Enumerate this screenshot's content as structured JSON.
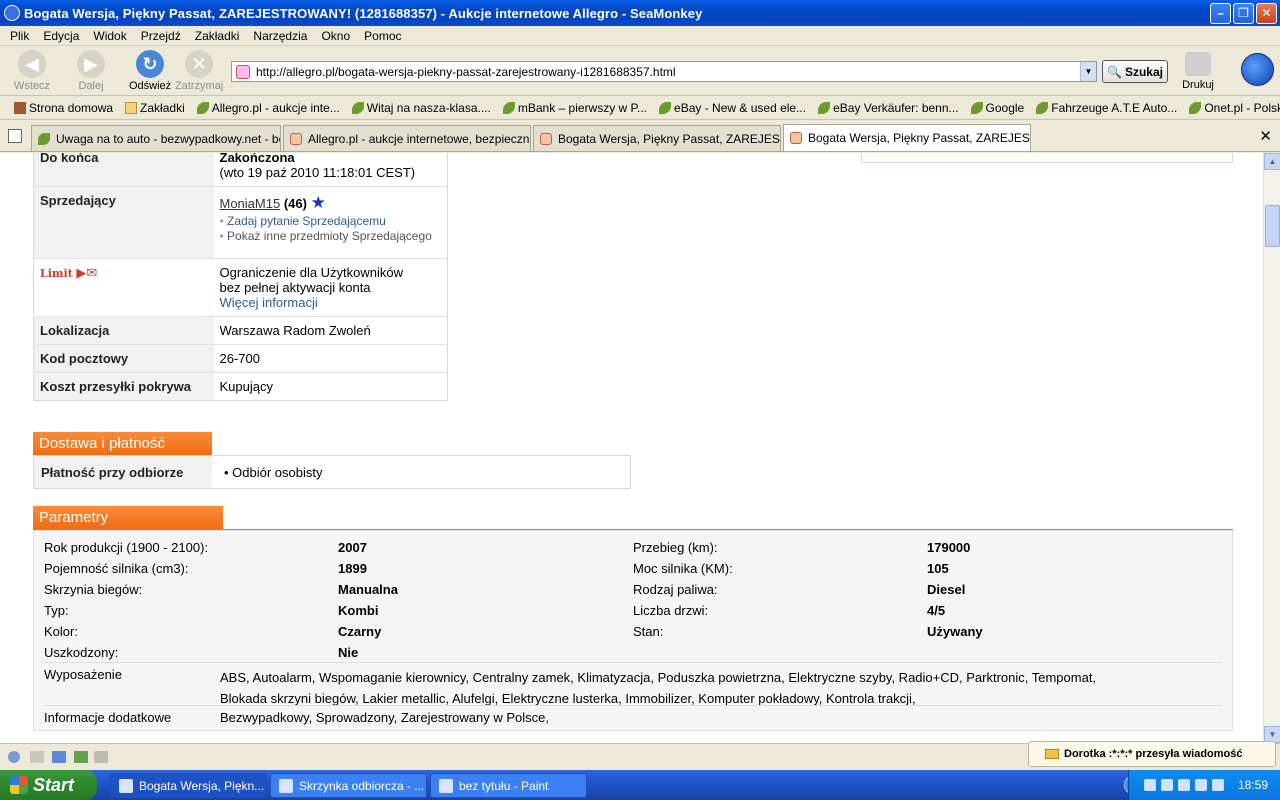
{
  "window": {
    "title": "Bogata Wersja, Piękny Passat, ZAREJESTROWANY! (1281688357) - Aukcje internetowe Allegro - SeaMonkey"
  },
  "menu": [
    "Plik",
    "Edycja",
    "Widok",
    "Przejdź",
    "Zakładki",
    "Narzędzia",
    "Okno",
    "Pomoc"
  ],
  "nav": {
    "back": "Wstecz",
    "forward": "Dalej",
    "reload": "Odśwież",
    "stop": "Zatrzymaj",
    "url": "http://allegro.pl/bogata-wersja-piekny-passat-zarejestrowany-i1281688357.html",
    "search": "Szukaj",
    "print": "Drukuj"
  },
  "bookmarks": [
    "Strona domowa",
    "Zakładki",
    "Allegro.pl - aukcje inte...",
    "Witaj na nasza-klasa....",
    "mBank – pierwszy w P...",
    "eBay - New & used ele...",
    "eBay Verkäufer: benn...",
    "Google",
    "Fahrzeuge A.T.E Auto...",
    "Onet.pl - Polski Portal ..."
  ],
  "tabs": [
    "Uwaga na to auto - bezwypadkowy.net - be...",
    "Allegro.pl - aukcje internetowe, bezpieczne ...",
    "Bogata Wersja, Piękny Passat, ZAREJESTR...",
    "Bogata Wersja, Piękny Passat, ZAREJESTR..."
  ],
  "auction": {
    "end_label": "Do końca",
    "end_value": "Zakończona",
    "end_date": "(wto 19 paź 2010 11:18:01 CEST)",
    "seller_label": "Sprzedający",
    "seller_name": "MoniaM15",
    "seller_count": "(46)",
    "ask_seller": "Zadaj pytanie Sprzedającemu",
    "other_items": "Pokaż inne przedmioty Sprzedającego",
    "limit_logo": "Limit",
    "limit_line1": "Ograniczenie dla Użytkowników",
    "limit_line2": "bez pełnej aktywacji konta",
    "more_info": "Więcej informacji",
    "location_label": "Lokalizacja",
    "location_value": "Warszawa Radom Zwoleń",
    "postcode_label": "Kod pocztowy",
    "postcode_value": "26-700",
    "shipping_label": "Koszt przesyłki pokrywa",
    "shipping_value": "Kupujący"
  },
  "delivery": {
    "header": "Dostawa i płatność",
    "label": "Płatność przy odbiorze",
    "value": "Odbiór osobisty"
  },
  "params": {
    "header": "Parametry",
    "rows": [
      {
        "k1": "Rok produkcji (1900 - 2100):",
        "v1": "2007",
        "k2": "Przebieg (km):",
        "v2": "179000"
      },
      {
        "k1": "Pojemność silnika (cm3):",
        "v1": "1899",
        "k2": "Moc silnika (KM):",
        "v2": "105"
      },
      {
        "k1": "Skrzynia biegów:",
        "v1": "Manualna",
        "k2": "Rodzaj paliwa:",
        "v2": "Diesel"
      },
      {
        "k1": "Typ:",
        "v1": "Kombi",
        "k2": "Liczba drzwi:",
        "v2": "4/5"
      },
      {
        "k1": "Kolor:",
        "v1": "Czarny",
        "k2": "Stan:",
        "v2": "Używany"
      },
      {
        "k1": "Uszkodzony:",
        "v1": "Nie",
        "k2": "",
        "v2": ""
      }
    ],
    "equipment_label": "Wyposażenie",
    "equipment_line1": "ABS, Autoalarm, Wspomaganie kierownicy, Centralny zamek, Klimatyzacja, Poduszka powietrzna, Elektryczne szyby, Radio+CD, Parktronic, Tempomat,",
    "equipment_line2": "Blokada skrzyni biegów, Lakier metallic, Alufelgi, Elektryczne lusterka, Immobilizer, Komputer pokładowy, Kontrola trakcji,",
    "additional_label": "Informacje dodatkowe",
    "additional_value": "Bezwypadkowy, Sprowadzony, Zarejestrowany w Polsce,"
  },
  "notification": "Dorotka :*:*:* przesyła wiadomość",
  "taskbar": {
    "start": "Start",
    "tasks": [
      "Bogata Wersja, Piękn...",
      "Skrzynka odbiorcza - ...",
      "bez tytułu - Paint"
    ],
    "clock": "18:59"
  }
}
